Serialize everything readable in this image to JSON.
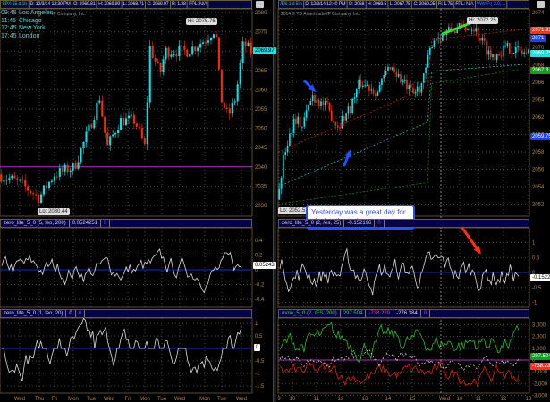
{
  "left": {
    "header": [
      "SPX 55 d 1h",
      "D: 12/3/14 12:30 PM",
      "O: 2069.81",
      "H: 2069.99",
      "L: 2068.71",
      "C: 2069.97",
      "R: 1.28",
      "FPL: N/A"
    ],
    "copyright": "IP Company, Inc.",
    "clocks": [
      {
        "time": "09:45",
        "city": "Los Angeles"
      },
      {
        "time": "11:45",
        "city": "Chicago"
      },
      {
        "time": "12:45",
        "city": "New York"
      },
      {
        "time": "17:45",
        "city": "London"
      }
    ],
    "hi_label": "Hi: 2075.76",
    "lo_label": "Lo: 2030.44",
    "price_tag": "2069.97",
    "y_ticks": [
      2080,
      2075,
      2070,
      2065,
      2060,
      2055,
      2050,
      2045,
      2040,
      2035,
      2030
    ],
    "reference_line": 2040,
    "price_anchors": [
      [
        0,
        2038
      ],
      [
        0.08,
        2036
      ],
      [
        0.16,
        2032
      ],
      [
        0.22,
        2038
      ],
      [
        0.3,
        2040
      ],
      [
        0.36,
        2050
      ],
      [
        0.4,
        2058
      ],
      [
        0.43,
        2045
      ],
      [
        0.48,
        2052
      ],
      [
        0.54,
        2052
      ],
      [
        0.58,
        2045
      ],
      [
        0.6,
        2071
      ],
      [
        0.64,
        2064
      ],
      [
        0.66,
        2070
      ],
      [
        0.75,
        2070
      ],
      [
        0.82,
        2073
      ],
      [
        0.86,
        2076
      ],
      [
        0.88,
        2058
      ],
      [
        0.91,
        2053
      ],
      [
        0.94,
        2058
      ],
      [
        0.97,
        2072
      ],
      [
        1,
        2069.97
      ]
    ],
    "study1": {
      "header": [
        "zero_lite_5_0 (5, leo, 200)",
        "0.0524251",
        "0"
      ],
      "tag": "0.05243",
      "ticks": [
        "0.4",
        "0.2",
        "0",
        "-0.2",
        "-0.4"
      ]
    },
    "study2": {
      "header": [
        "zero_lite_5_0 (1, leo, 20)",
        "0",
        "0"
      ],
      "tag": "0",
      "ticks": [
        "1",
        "0.5",
        "0",
        "-0.5",
        "-1",
        "-1.5"
      ]
    },
    "x_labels": [
      "Wed",
      "Thu",
      "Fri",
      "Mon",
      "Tue",
      "Wed",
      "Fri",
      "Mon",
      "Tue",
      "Wed",
      "Mon",
      "Tue",
      "Wed"
    ]
  },
  "right": {
    "header": [
      "/ES 1 d 5m",
      "D: 12/3/14 12:40 PM",
      "O: 2068",
      "H: 2069.5",
      "L: 2067.75",
      "C: 2069.25",
      "R: 1.75",
      "FPL: N/A",
      "VWAP (-2.0, ..."
    ],
    "copyright": "2014 © TD Ameritrade IP Company, Inc.",
    "hi_label": "Hi: 2072.25",
    "lo_label": "Lo: 2052.5",
    "price_tags": [
      {
        "value": "2071.91",
        "price": 2071.91,
        "color": "#ff3020"
      },
      {
        "value": "2071",
        "price": 2071,
        "color": "#2040ff"
      },
      {
        "value": "2069.25",
        "price": 2069.25,
        "color": "#20e0e0"
      },
      {
        "value": "2067.3",
        "price": 2067.3,
        "color": "#10a020"
      },
      {
        "value": "2059.75",
        "price": 2059.75,
        "color": "#2040ff"
      }
    ],
    "y_ticks": [
      2074,
      2072,
      2070,
      2068,
      2066,
      2064,
      2062,
      2060,
      2058,
      2056,
      2054,
      2052
    ],
    "price_anchors": [
      [
        0,
        2052.5
      ],
      [
        0.03,
        2058
      ],
      [
        0.07,
        2062
      ],
      [
        0.1,
        2061
      ],
      [
        0.14,
        2064.5
      ],
      [
        0.2,
        2063
      ],
      [
        0.24,
        2061
      ],
      [
        0.29,
        2063
      ],
      [
        0.33,
        2066
      ],
      [
        0.4,
        2065
      ],
      [
        0.45,
        2068
      ],
      [
        0.5,
        2066
      ],
      [
        0.54,
        2064.5
      ],
      [
        0.58,
        2066
      ],
      [
        0.62,
        2071
      ],
      [
        0.7,
        2072
      ],
      [
        0.78,
        2072.5
      ],
      [
        0.85,
        2069
      ],
      [
        0.92,
        2070
      ],
      [
        1,
        2069.25
      ]
    ],
    "annotation": "Yesterday was a great day for playing the swings.",
    "study1": {
      "header": [
        "zero_lite_5_0 (2, /es, 25)",
        "-0.152196",
        "0"
      ],
      "tag": "-0.1522",
      "ticks": [
        "1",
        "0.5",
        "0",
        "-0.5",
        "-1"
      ]
    },
    "study2": {
      "header": [
        "mole_5_0 (2, /ES, 200)",
        "297.504",
        "-738.229",
        "-276.384",
        "0"
      ],
      "tags": [
        {
          "value": "297.504",
          "color": "#10a020"
        },
        {
          "value": "-738.23",
          "color": "#ff3020"
        }
      ],
      "ticks": [
        "3,000",
        "2,000",
        "1,000",
        "0",
        "-1,000",
        "-2,000",
        "-3,000"
      ]
    },
    "x_labels": [
      "9",
      "10",
      "11",
      "12",
      "13",
      "14",
      "15",
      "Wed",
      "10",
      "11",
      "12",
      "13"
    ]
  },
  "colors": {
    "up": "#00e5ee",
    "down": "#ff2a00",
    "axis_text": "#b08850",
    "grid": "#5a4a30",
    "zero_line": "#1530c0",
    "magenta": "#b030c0"
  }
}
